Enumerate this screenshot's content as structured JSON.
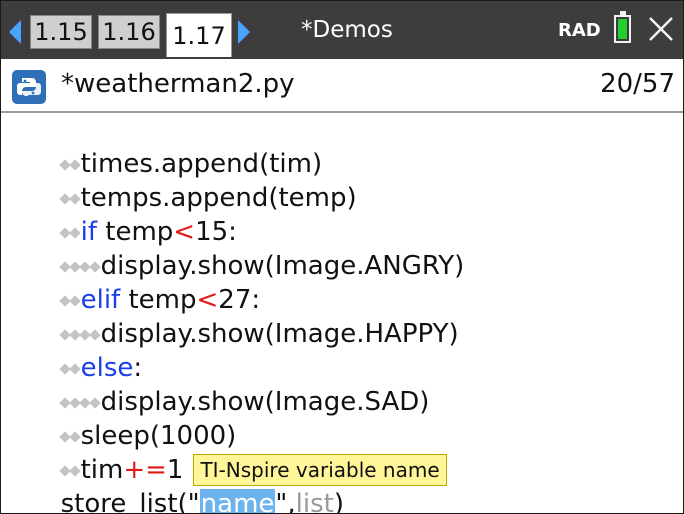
{
  "tabs": [
    {
      "label": "1.15",
      "active": false
    },
    {
      "label": "1.16",
      "active": false
    },
    {
      "label": "1.17",
      "active": true
    }
  ],
  "document_title": "*Demos",
  "angle_mode": "RAD",
  "file": {
    "name": "*weatherman2.py",
    "line_position": "20/57"
  },
  "code_lines": [
    {
      "indent": 2,
      "text": "times.append(tim)"
    },
    {
      "indent": 2,
      "text": "temps.append(temp)"
    },
    {
      "indent": 2,
      "keyword": "if",
      "pre": " temp",
      "op": "<",
      "post": "15:"
    },
    {
      "indent": 4,
      "text": "display.show(Image.ANGRY)"
    },
    {
      "indent": 2,
      "keyword": "elif",
      "pre": " temp",
      "op": "<",
      "post": "27:"
    },
    {
      "indent": 4,
      "text": "display.show(Image.HAPPY)"
    },
    {
      "indent": 2,
      "keyword": "else",
      "post": ":"
    },
    {
      "indent": 4,
      "text": "display.show(Image.SAD)"
    },
    {
      "indent": 2,
      "text": "sleep(1000)"
    },
    {
      "indent": 2,
      "pre": "tim",
      "op": "+=",
      "post": "1"
    }
  ],
  "tooltip": "TI-Nspire variable name",
  "current_line": {
    "prefix": "store_list(\"",
    "selected": "name",
    "middle": "\",",
    "placeholder": "list",
    "suffix": ")"
  },
  "colors": {
    "tabbar_bg": "#3d3d3d",
    "keyword": "#1a3ee8",
    "operator": "#e01919",
    "selection": "#6db3ee",
    "tooltip_bg": "#fff69a",
    "battery": "#22d02d",
    "arrow": "#4aa3ff"
  }
}
